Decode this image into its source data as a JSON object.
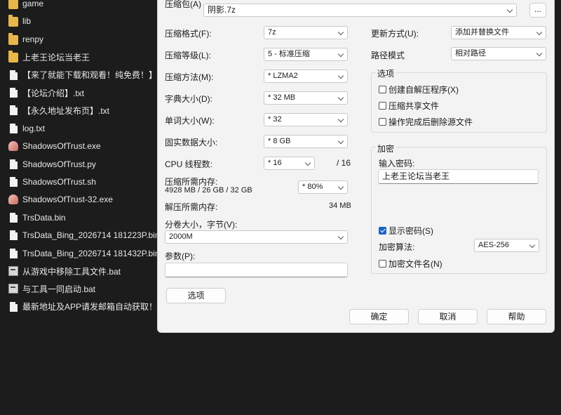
{
  "files": [
    {
      "name": "game",
      "icon": "folder-icon"
    },
    {
      "name": "lib",
      "icon": "folder-icon"
    },
    {
      "name": "renpy",
      "icon": "folder-icon"
    },
    {
      "name": "上老王论坛当老王",
      "icon": "folder-icon"
    },
    {
      "name": "【来了就能下载和观看！纯免费！】.txt",
      "icon": "text-file-icon"
    },
    {
      "name": "【论坛介绍】.txt",
      "icon": "text-file-icon"
    },
    {
      "name": "【永久地址发布页】.txt",
      "icon": "text-file-icon"
    },
    {
      "name": "log.txt",
      "icon": "text-file-icon"
    },
    {
      "name": "ShadowsOfTrust.exe",
      "icon": "exe-icon"
    },
    {
      "name": "ShadowsOfTrust.py",
      "icon": "text-file-icon"
    },
    {
      "name": "ShadowsOfTrust.sh",
      "icon": "text-file-icon"
    },
    {
      "name": "ShadowsOfTrust-32.exe",
      "icon": "exe-icon"
    },
    {
      "name": "TrsData.bin",
      "icon": "text-file-icon"
    },
    {
      "name": "TrsData_Bing_2026714 181223P.bin",
      "icon": "text-file-icon"
    },
    {
      "name": "TrsData_Bing_2026714 181432P.bin",
      "icon": "text-file-icon"
    },
    {
      "name": "从游戏中移除工具文件.bat",
      "icon": "bat-file-icon"
    },
    {
      "name": "与工具一同启动.bat",
      "icon": "bat-file-icon"
    },
    {
      "name": "最新地址及APP请发邮箱自动获取！！！",
      "icon": "text-file-icon"
    }
  ],
  "dialog": {
    "archive_label": "压缩包(A)",
    "archive_value": "阴影.7z",
    "browse_label": "...",
    "left": {
      "format_label": "压缩格式(F):",
      "format_value": "7z",
      "level_label": "压缩等级(L):",
      "level_value": "5 - 标准压缩",
      "method_label": "压缩方法(M):",
      "method_value": "* LZMA2",
      "dict_label": "字典大小(D):",
      "dict_value": "* 32 MB",
      "word_label": "单词大小(W):",
      "word_value": "* 32",
      "solid_label": "固实数据大小:",
      "solid_value": "* 8 GB",
      "cpu_label": "CPU 线程数:",
      "cpu_value": "* 16",
      "cpu_total": "/ 16",
      "mem_comp_label": "压缩所需内存:",
      "mem_comp_detail": "4928 MB / 26 GB / 32 GB",
      "mem_percent": "* 80%",
      "mem_decomp_label": "解压所需内存:",
      "mem_decomp_value": "34 MB",
      "split_label": "分卷大小，字节(V):",
      "split_value": "2000M",
      "params_label": "参数(P):",
      "params_value": "",
      "options_button": "选项"
    },
    "right": {
      "update_label": "更新方式(U):",
      "update_value": "添加并替换文件",
      "path_label": "路径模式",
      "path_value": "相对路径",
      "options_group": "选项",
      "sfx_label": "创建自解压程序(X)",
      "sfx_checked": false,
      "shared_label": "压缩共享文件",
      "shared_checked": false,
      "delete_label": "操作完成后删除源文件",
      "delete_checked": false,
      "encrypt_group": "加密",
      "password_label": "输入密码:",
      "password_value": "上老王论坛当老王",
      "show_pwd_label": "显示密码(S)",
      "show_pwd_checked": true,
      "algo_label": "加密算法:",
      "algo_value": "AES-256",
      "encrypt_names_label": "加密文件名(N)",
      "encrypt_names_checked": false
    },
    "buttons": {
      "ok": "确定",
      "cancel": "取消",
      "help": "帮助"
    }
  }
}
